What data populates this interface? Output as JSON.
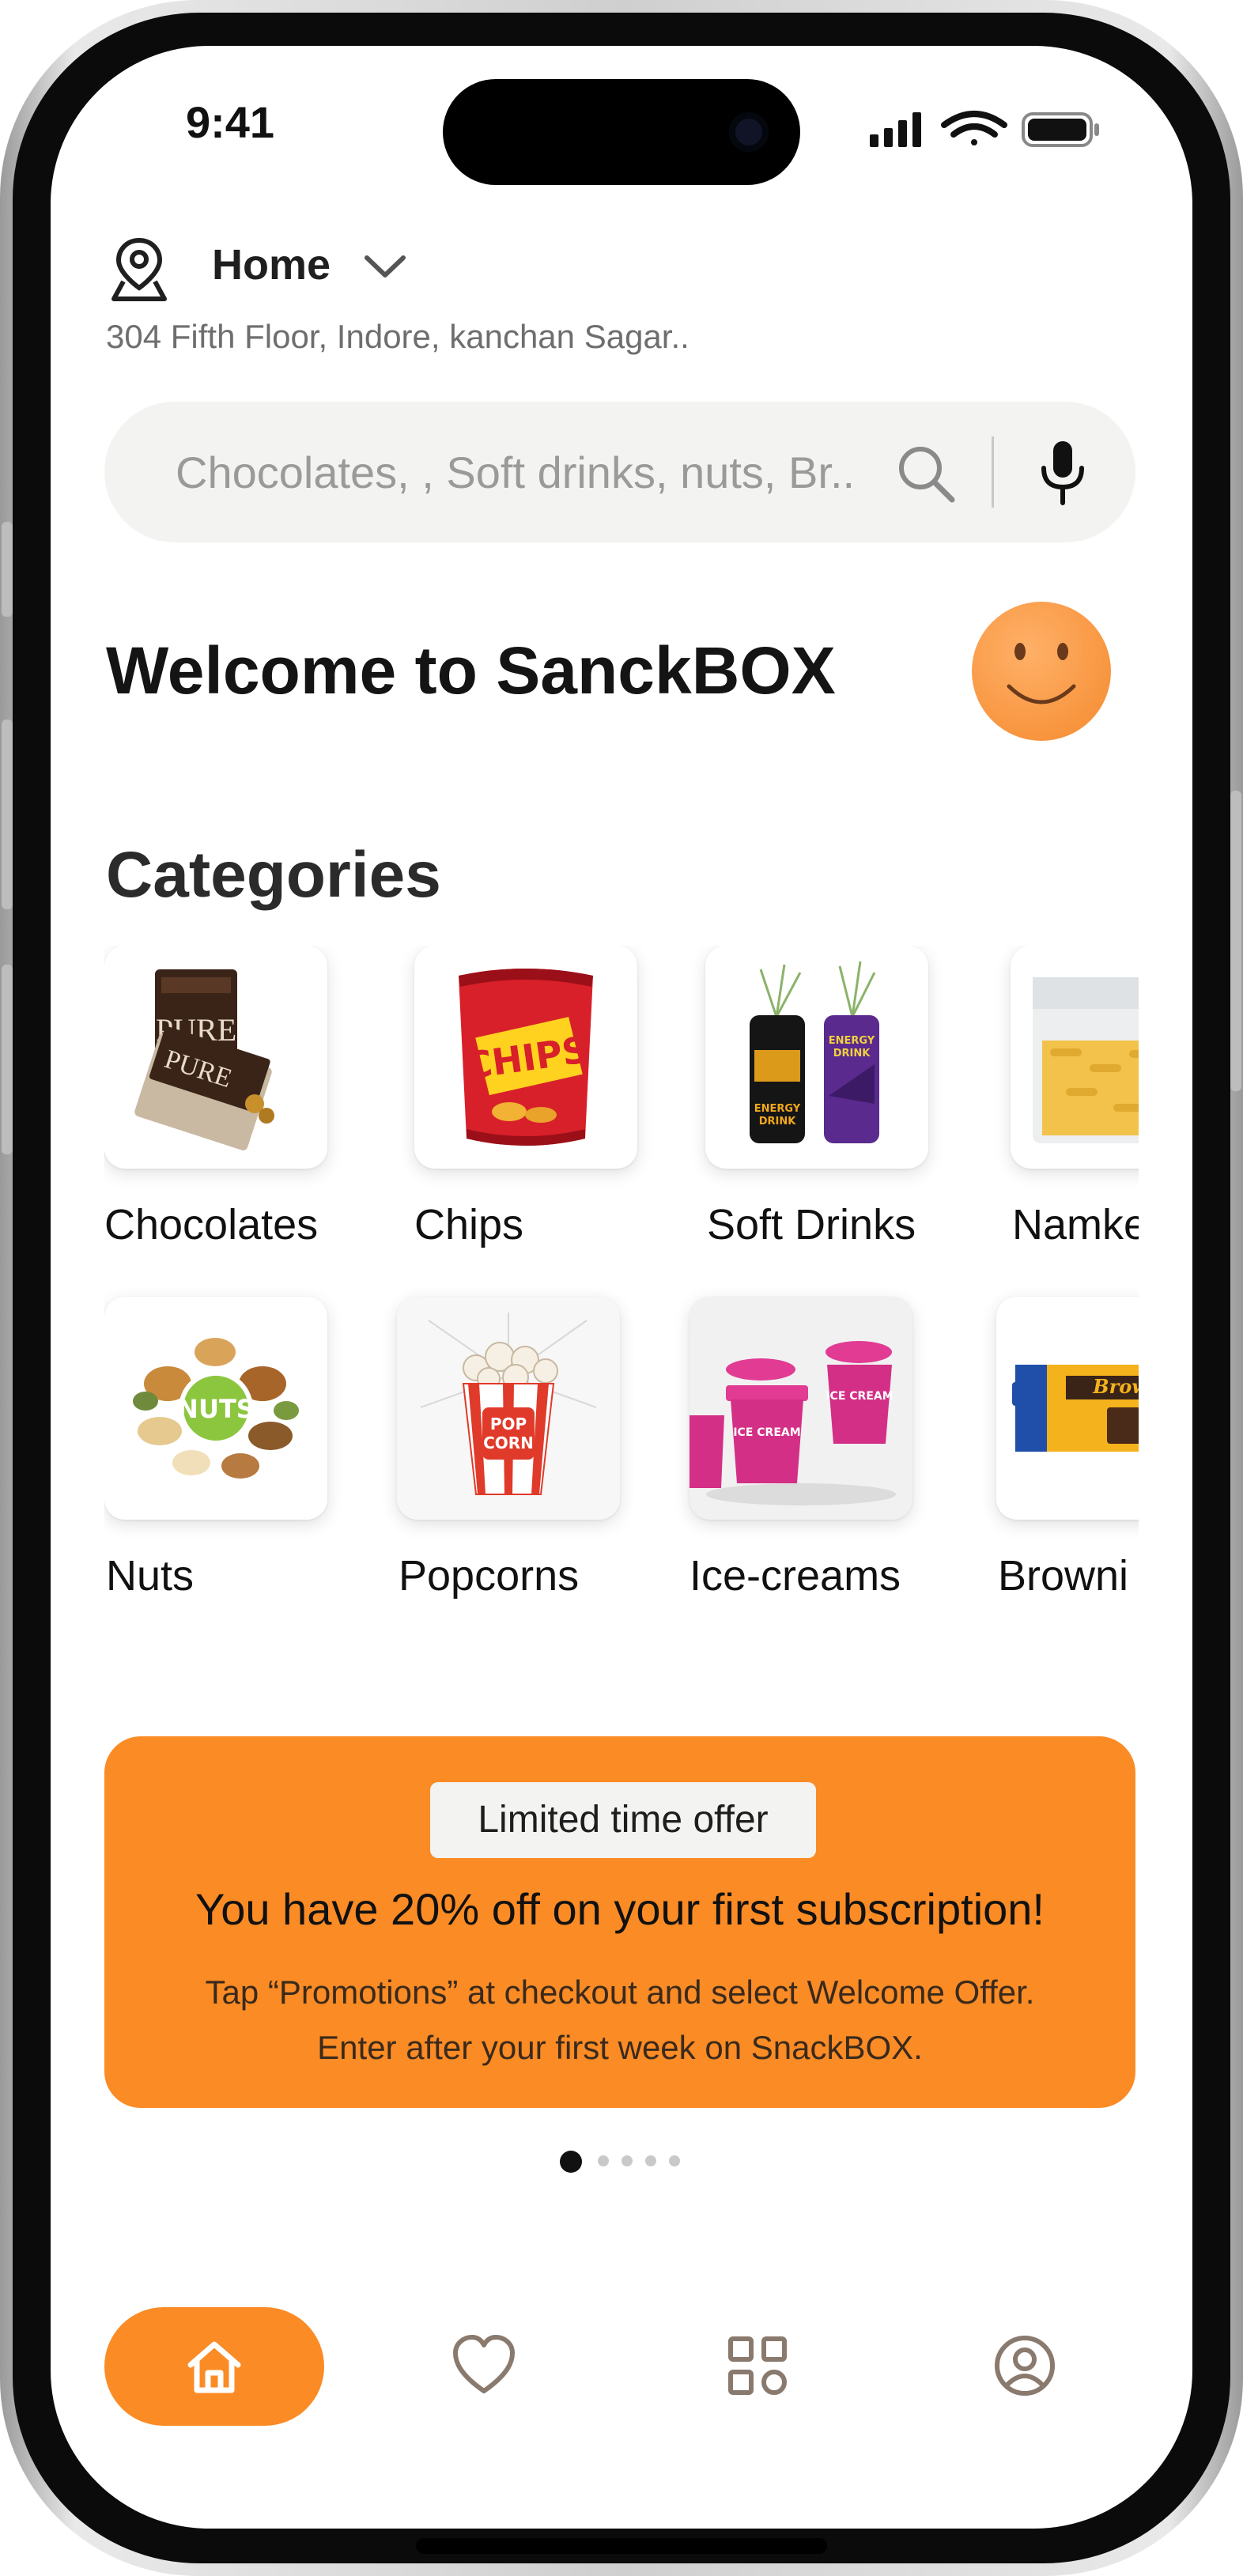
{
  "status_bar": {
    "time": "9:41"
  },
  "location": {
    "title": "Home",
    "address": "304 Fifth Floor, Indore, kanchan Sagar.."
  },
  "search": {
    "placeholder": "Chocolates, , Soft drinks, nuts, Br.."
  },
  "welcome": {
    "text": "Welcome to SanckBOX"
  },
  "categories": {
    "title": "Categories",
    "items": [
      {
        "label": "Chocolates",
        "icon": "chocolate-bars-image"
      },
      {
        "label": "Chips",
        "icon": "chips-packet-image"
      },
      {
        "label": "Soft Drinks",
        "icon": "energy-drink-cans-image"
      },
      {
        "label": "Namke",
        "icon": "namkeen-packet-image"
      },
      {
        "label": "Nuts",
        "icon": "mixed-nuts-image"
      },
      {
        "label": "Popcorns",
        "icon": "popcorn-bucket-image"
      },
      {
        "label": "Ice-creams",
        "icon": "ice-cream-tubs-image"
      },
      {
        "label": "Browni",
        "icon": "brownie-packet-image"
      }
    ]
  },
  "promo": {
    "badge": "Limited time offer",
    "title": "You have 20% off on your first subscription!",
    "line1": "Tap “Promotions” at checkout and select Welcome Offer.",
    "line2": "Enter after your first week on SnackBOX."
  },
  "carousel": {
    "pages": 5,
    "active": 0
  },
  "bottom_nav": {
    "items": [
      {
        "name": "home",
        "icon": "home-icon",
        "active": true
      },
      {
        "name": "favorites",
        "icon": "heart-icon",
        "active": false
      },
      {
        "name": "categories",
        "icon": "grid-icon",
        "active": false
      },
      {
        "name": "profile",
        "icon": "user-circle-icon",
        "active": false
      }
    ]
  },
  "colors": {
    "accent": "#fb8b25",
    "search_bg": "#f3f3f1",
    "text_dark": "#141414",
    "text_muted": "#6e6e6e",
    "nav_icon": "#8a7a6e"
  }
}
